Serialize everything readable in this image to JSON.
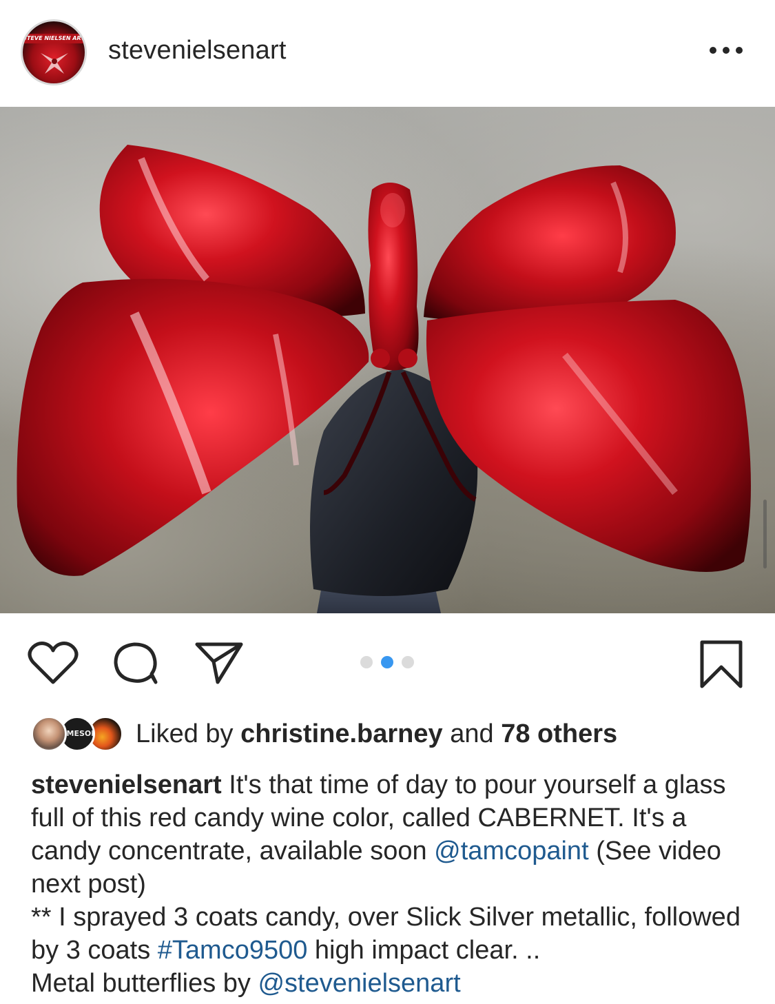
{
  "header": {
    "avatar_banner_text": "STEVE NIELSEN ART",
    "username": "stevenielsenart",
    "more_icon": "more-horizontal-icon"
  },
  "post_image": {
    "carousel_total": 3,
    "carousel_active_index": 1
  },
  "actions": {
    "icons": [
      "heart-icon",
      "comment-icon",
      "share-icon",
      "bookmark-icon"
    ],
    "accent_color": "#3897f0"
  },
  "likes": {
    "prefix": "Liked by ",
    "first_liker": "christine.barney",
    "conjunction": " and ",
    "others": "78 others",
    "liker_avatar_2_text": "EMESON"
  },
  "caption": {
    "author": "stevenielsenart",
    "text_1": " It's that time of day to pour yourself a glass full of this red candy wine color,  called CABERNET. It's a candy concentrate, available soon ",
    "mention_1": "@tamcopaint",
    "text_2": " (See video next post)",
    "text_3": "** I sprayed 3 coats candy, over Slick Silver metallic, followed by 3 coats ",
    "hashtag_1": "#Tamco9500",
    "text_4": " high impact clear. ..",
    "text_5": "Metal butterflies by ",
    "mention_2": "@stevenielsenart",
    "link_color": "#1f5a8f"
  }
}
